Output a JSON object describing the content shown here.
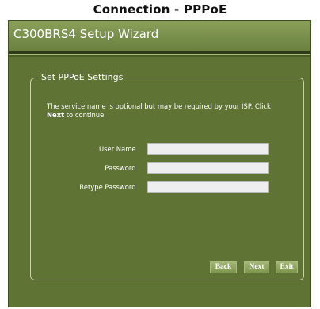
{
  "caption": "Connection - PPPoE",
  "window": {
    "title": "C300BRS4 Setup Wizard"
  },
  "panel": {
    "legend": "Set PPPoE Settings",
    "description_before": "The service name is optional but may be required by your ISP. Click ",
    "description_bold": "Next",
    "description_after": " to continue."
  },
  "fields": {
    "username_label": "User Name :",
    "username_value": "",
    "password_label": "Password :",
    "password_value": "",
    "retype_label": "Retype Password :",
    "retype_value": ""
  },
  "buttons": {
    "back": "Back",
    "next": "Next",
    "exit": "Exit"
  }
}
